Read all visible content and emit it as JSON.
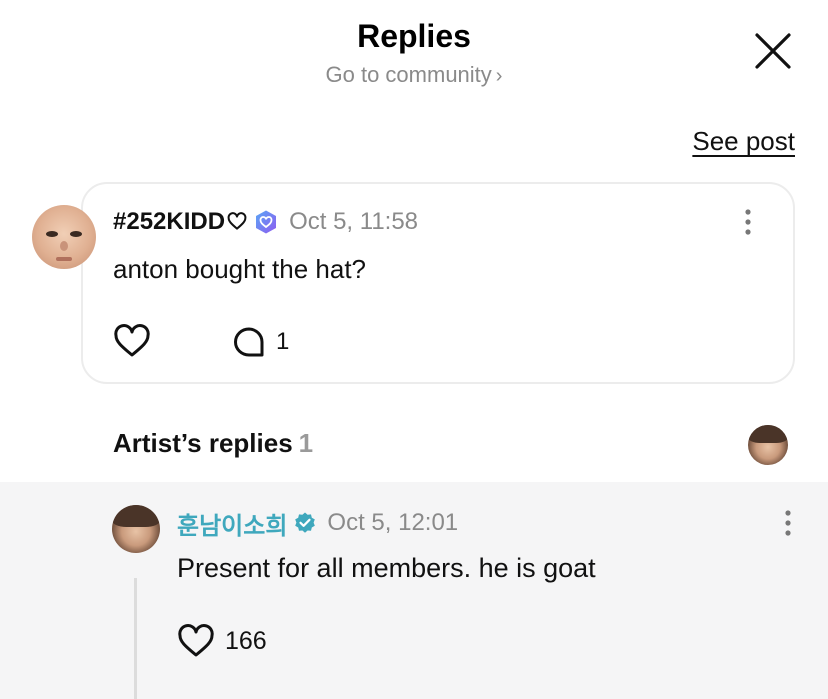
{
  "header": {
    "title": "Replies",
    "subtitle": "Go to community",
    "subtitle_chevron": "chevron-right-icon",
    "close_icon": "close-icon"
  },
  "see_post": "See post",
  "post": {
    "author": "#252KIDD",
    "author_heart_icon": "heart-outline-icon",
    "badge_icon": "membership-badge-icon",
    "timestamp": "Oct 5, 11:58",
    "text": "anton bought the hat?",
    "comment_count": "1"
  },
  "artist_replies": {
    "label": "Artist’s replies",
    "count": "1"
  },
  "reply": {
    "author": "훈남이소희",
    "verified_color": "#3fa8bd",
    "timestamp": "Oct 5, 12:01",
    "text": "Present for all members. he is goat",
    "like_count": "166"
  }
}
